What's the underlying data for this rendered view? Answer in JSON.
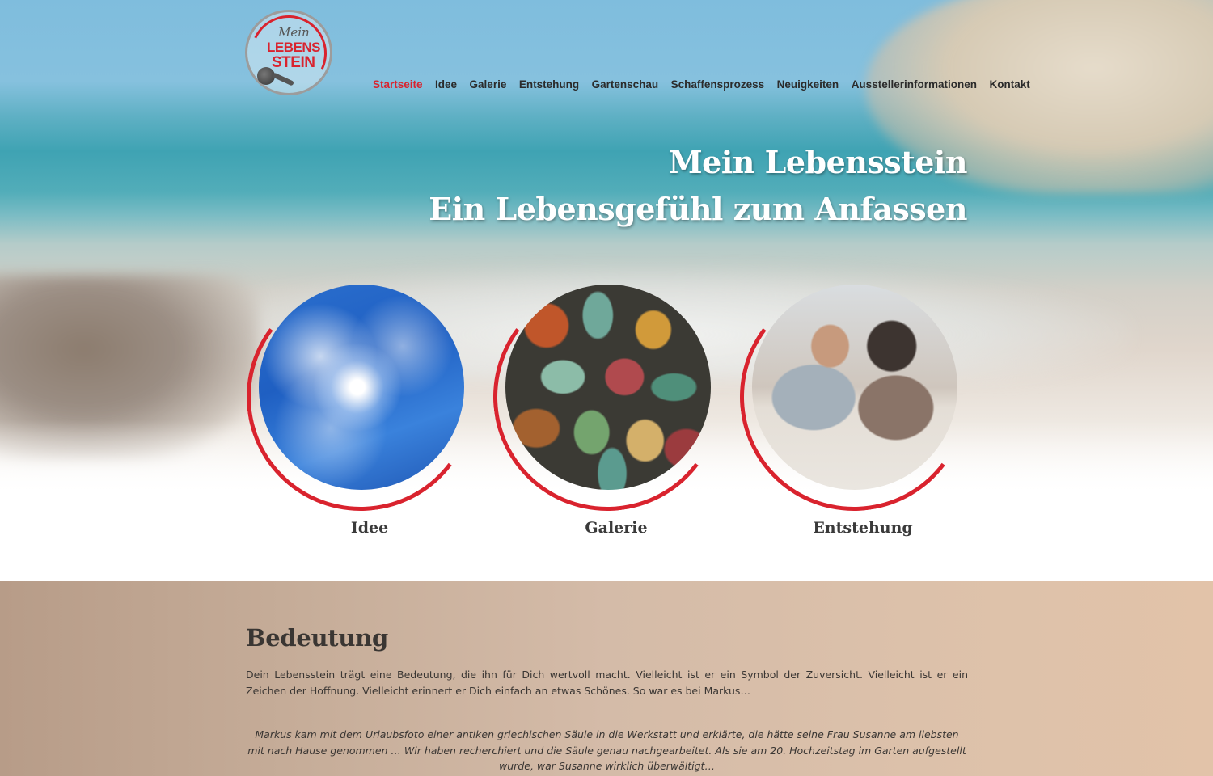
{
  "logo": {
    "line1": "Mein",
    "line2": "LEBENS",
    "line3": "STEIN"
  },
  "nav": {
    "items": [
      {
        "label": "Startseite",
        "active": true
      },
      {
        "label": "Idee",
        "active": false
      },
      {
        "label": "Galerie",
        "active": false
      },
      {
        "label": "Entstehung",
        "active": false
      },
      {
        "label": "Gartenschau",
        "active": false
      },
      {
        "label": "Schaffensprozess",
        "active": false
      },
      {
        "label": "Neuigkeiten",
        "active": false
      },
      {
        "label": "Ausstellerinformationen",
        "active": false
      },
      {
        "label": "Kontakt",
        "active": false
      }
    ]
  },
  "hero": {
    "title_line1": "Mein Lebensstein",
    "title_line2": "Ein Lebensgefühl zum Anfassen"
  },
  "tiles": [
    {
      "label": "Idee",
      "image": "sky-sun"
    },
    {
      "label": "Galerie",
      "image": "colorful-stones"
    },
    {
      "label": "Entstehung",
      "image": "people-working"
    }
  ],
  "bedeutung": {
    "heading": "Bedeutung",
    "intro": "Dein Lebensstein trägt eine Bedeutung, die ihn für Dich wertvoll macht. Vielleicht ist er ein Symbol der Zuversicht. Vielleicht ist er ein Zeichen der Hoffnung. Vielleicht erinnert er Dich einfach an etwas Schönes. So war es bei Markus…",
    "story": "Markus kam mit dem Urlaubsfoto einer antiken griechischen Säule in die Werkstatt und erklärte, die hätte seine Frau Susanne am liebsten mit nach Hause genommen … Wir haben recherchiert und die Säule genau nachgearbeitet. Als sie am 20. Hochzeitstag im Garten aufgestellt wurde, war Susanne wirklich überwältigt…"
  },
  "colors": {
    "accent": "#d9232e",
    "text": "#2b2b2b",
    "hero_text": "#ffffff"
  }
}
